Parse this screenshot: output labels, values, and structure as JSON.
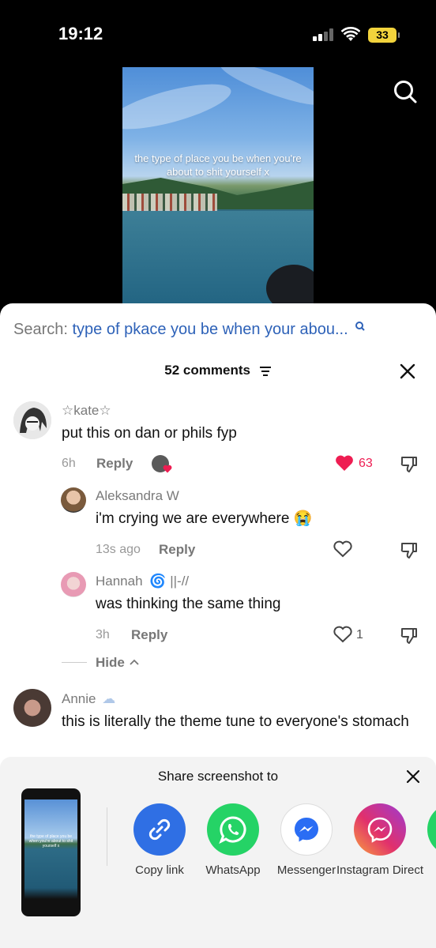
{
  "status_bar": {
    "time": "19:12",
    "battery": "33"
  },
  "video": {
    "caption": "the type of place you be when you're about to shit yourself x"
  },
  "search": {
    "label": "Search:",
    "query": "type of pkace you be when your abou..."
  },
  "comments_header": {
    "count_label": "52 comments"
  },
  "comments": [
    {
      "user": "☆kate☆",
      "text": "put this on dan or phils fyp",
      "time": "6h",
      "reply": "Reply",
      "likes": "63"
    },
    {
      "user": "Aleksandra W",
      "text": "i'm crying we are everywhere 😭",
      "time": "13s ago",
      "reply": "Reply",
      "likes": ""
    },
    {
      "user": "Hannah",
      "user_suffix": "||-//",
      "text": "was thinking the same thing",
      "time": "3h",
      "reply": "Reply",
      "likes": "1"
    },
    {
      "user": "Annie",
      "text": "this is literally the theme tune to everyone's stomach"
    }
  ],
  "hide_label": "Hide",
  "share": {
    "title": "Share screenshot to",
    "apps": [
      {
        "label": "Copy link",
        "icon": "link-icon",
        "color": "#2f6fe4"
      },
      {
        "label": "WhatsApp",
        "icon": "whatsapp-icon",
        "color": "#25d366"
      },
      {
        "label": "Messenger",
        "icon": "messenger-icon",
        "color": "#ffffff"
      },
      {
        "label": "Instagram Direct",
        "icon": "instagram-direct-icon",
        "color": "#e1306c"
      }
    ]
  },
  "colors": {
    "accent_blue": "#2e62b8",
    "like_red": "#ee1d52"
  }
}
